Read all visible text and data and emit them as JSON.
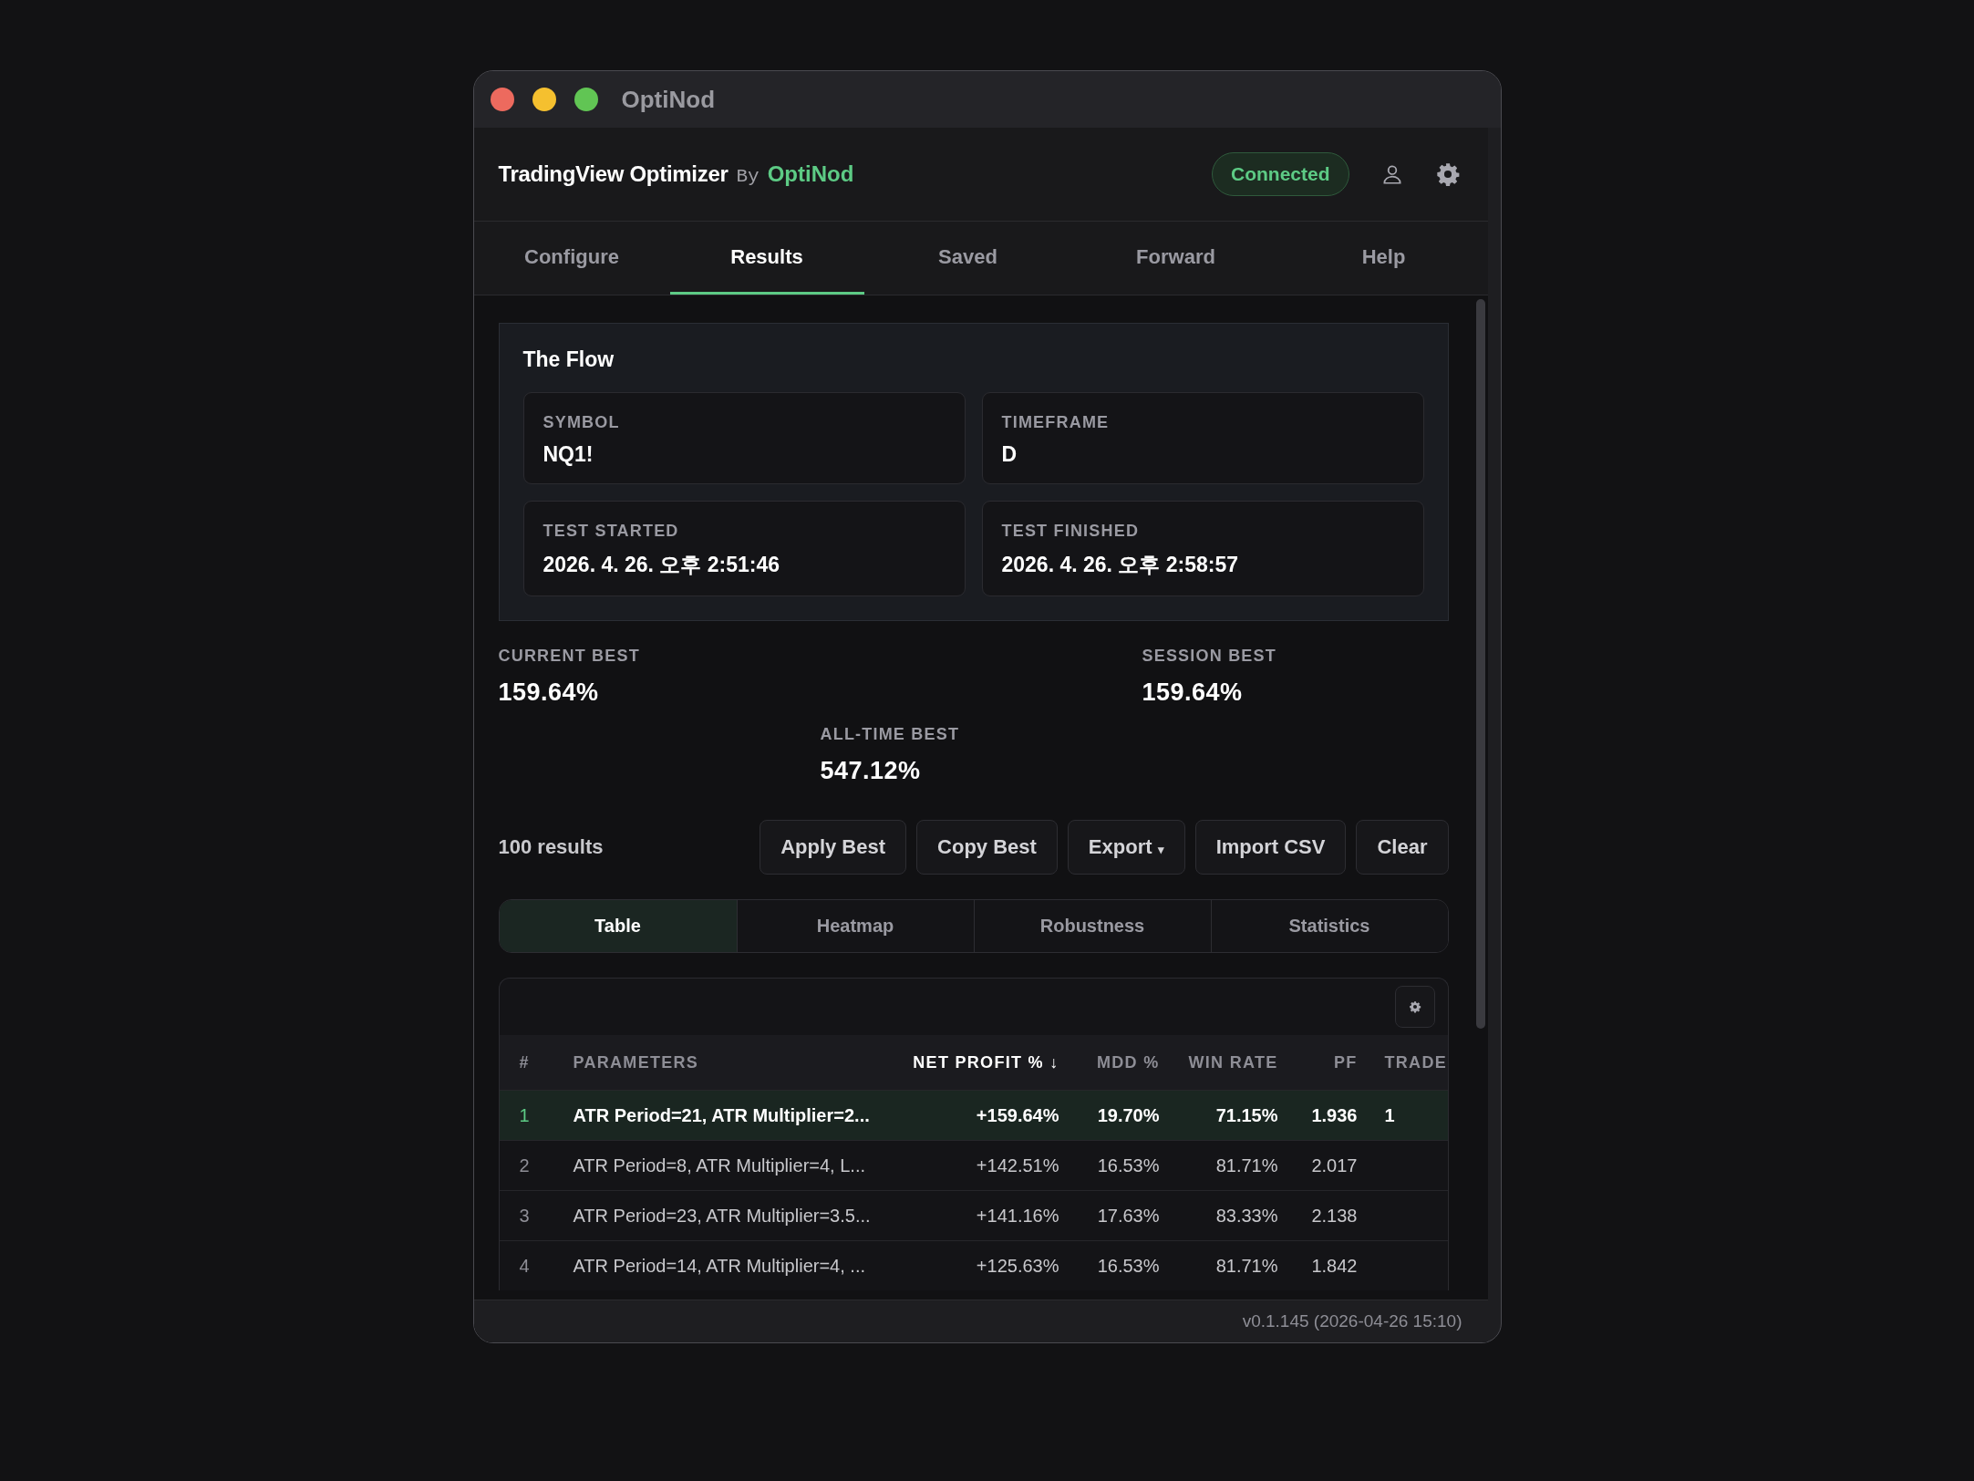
{
  "window": {
    "title": "OptiNod"
  },
  "header": {
    "title": "TradingView Optimizer",
    "by": "By",
    "brand": "OptiNod",
    "status": "Connected"
  },
  "tabs": [
    {
      "label": "Configure",
      "selected": false
    },
    {
      "label": "Results",
      "selected": true
    },
    {
      "label": "Saved",
      "selected": false
    },
    {
      "label": "Forward",
      "selected": false
    },
    {
      "label": "Help",
      "selected": false
    }
  ],
  "card": {
    "title": "The Flow",
    "fields": [
      {
        "label": "SYMBOL",
        "value": "NQ1!"
      },
      {
        "label": "TIMEFRAME",
        "value": "D"
      },
      {
        "label": "TEST STARTED",
        "value": "2026. 4. 26. 오후 2:51:46"
      },
      {
        "label": "TEST FINISHED",
        "value": "2026. 4. 26. 오후 2:58:57"
      }
    ]
  },
  "bests": [
    {
      "label": "CURRENT BEST",
      "value": "159.64%"
    },
    {
      "label": "SESSION BEST",
      "value": "159.64%"
    },
    {
      "label": "ALL-TIME BEST",
      "value": "547.12%"
    }
  ],
  "results_count": "100 results",
  "buttons": [
    {
      "label": "Apply Best",
      "kind": "button"
    },
    {
      "label": "Copy Best",
      "kind": "button"
    },
    {
      "label": "Export",
      "kind": "dropdown",
      "caret": "▾"
    },
    {
      "label": "Import CSV",
      "kind": "button"
    },
    {
      "label": "Clear",
      "kind": "button"
    }
  ],
  "view_tabs": [
    {
      "label": "Table",
      "selected": true
    },
    {
      "label": "Heatmap",
      "selected": false
    },
    {
      "label": "Robustness",
      "selected": false
    },
    {
      "label": "Statistics",
      "selected": false
    }
  ],
  "table": {
    "columns": [
      {
        "label": "#",
        "sorted": false
      },
      {
        "label": "PARAMETERS",
        "sorted": false
      },
      {
        "label": "NET PROFIT % ↓",
        "sorted": true
      },
      {
        "label": "MDD %",
        "sorted": false
      },
      {
        "label": "WIN RATE",
        "sorted": false
      },
      {
        "label": "PF",
        "sorted": false
      },
      {
        "label": "TRADE",
        "sorted": false
      }
    ],
    "rows": [
      {
        "selected": true,
        "cells": [
          "1",
          "ATR Period=21, ATR Multiplier=2...",
          "+159.64%",
          "19.70%",
          "71.15%",
          "1.936",
          "1"
        ]
      },
      {
        "selected": false,
        "cells": [
          "2",
          "ATR Period=8, ATR Multiplier=4, L...",
          "+142.51%",
          "16.53%",
          "81.71%",
          "2.017"
        ]
      },
      {
        "selected": false,
        "cells": [
          "3",
          "ATR Period=23, ATR Multiplier=3.5...",
          "+141.16%",
          "17.63%",
          "83.33%",
          "2.138"
        ]
      },
      {
        "selected": false,
        "cells": [
          "4",
          "ATR Period=14, ATR Multiplier=4, ...",
          "+125.63%",
          "16.53%",
          "81.71%",
          "1.842"
        ]
      }
    ]
  },
  "footer": {
    "version": "v0.1.145 (2026-04-26 15:10)"
  }
}
